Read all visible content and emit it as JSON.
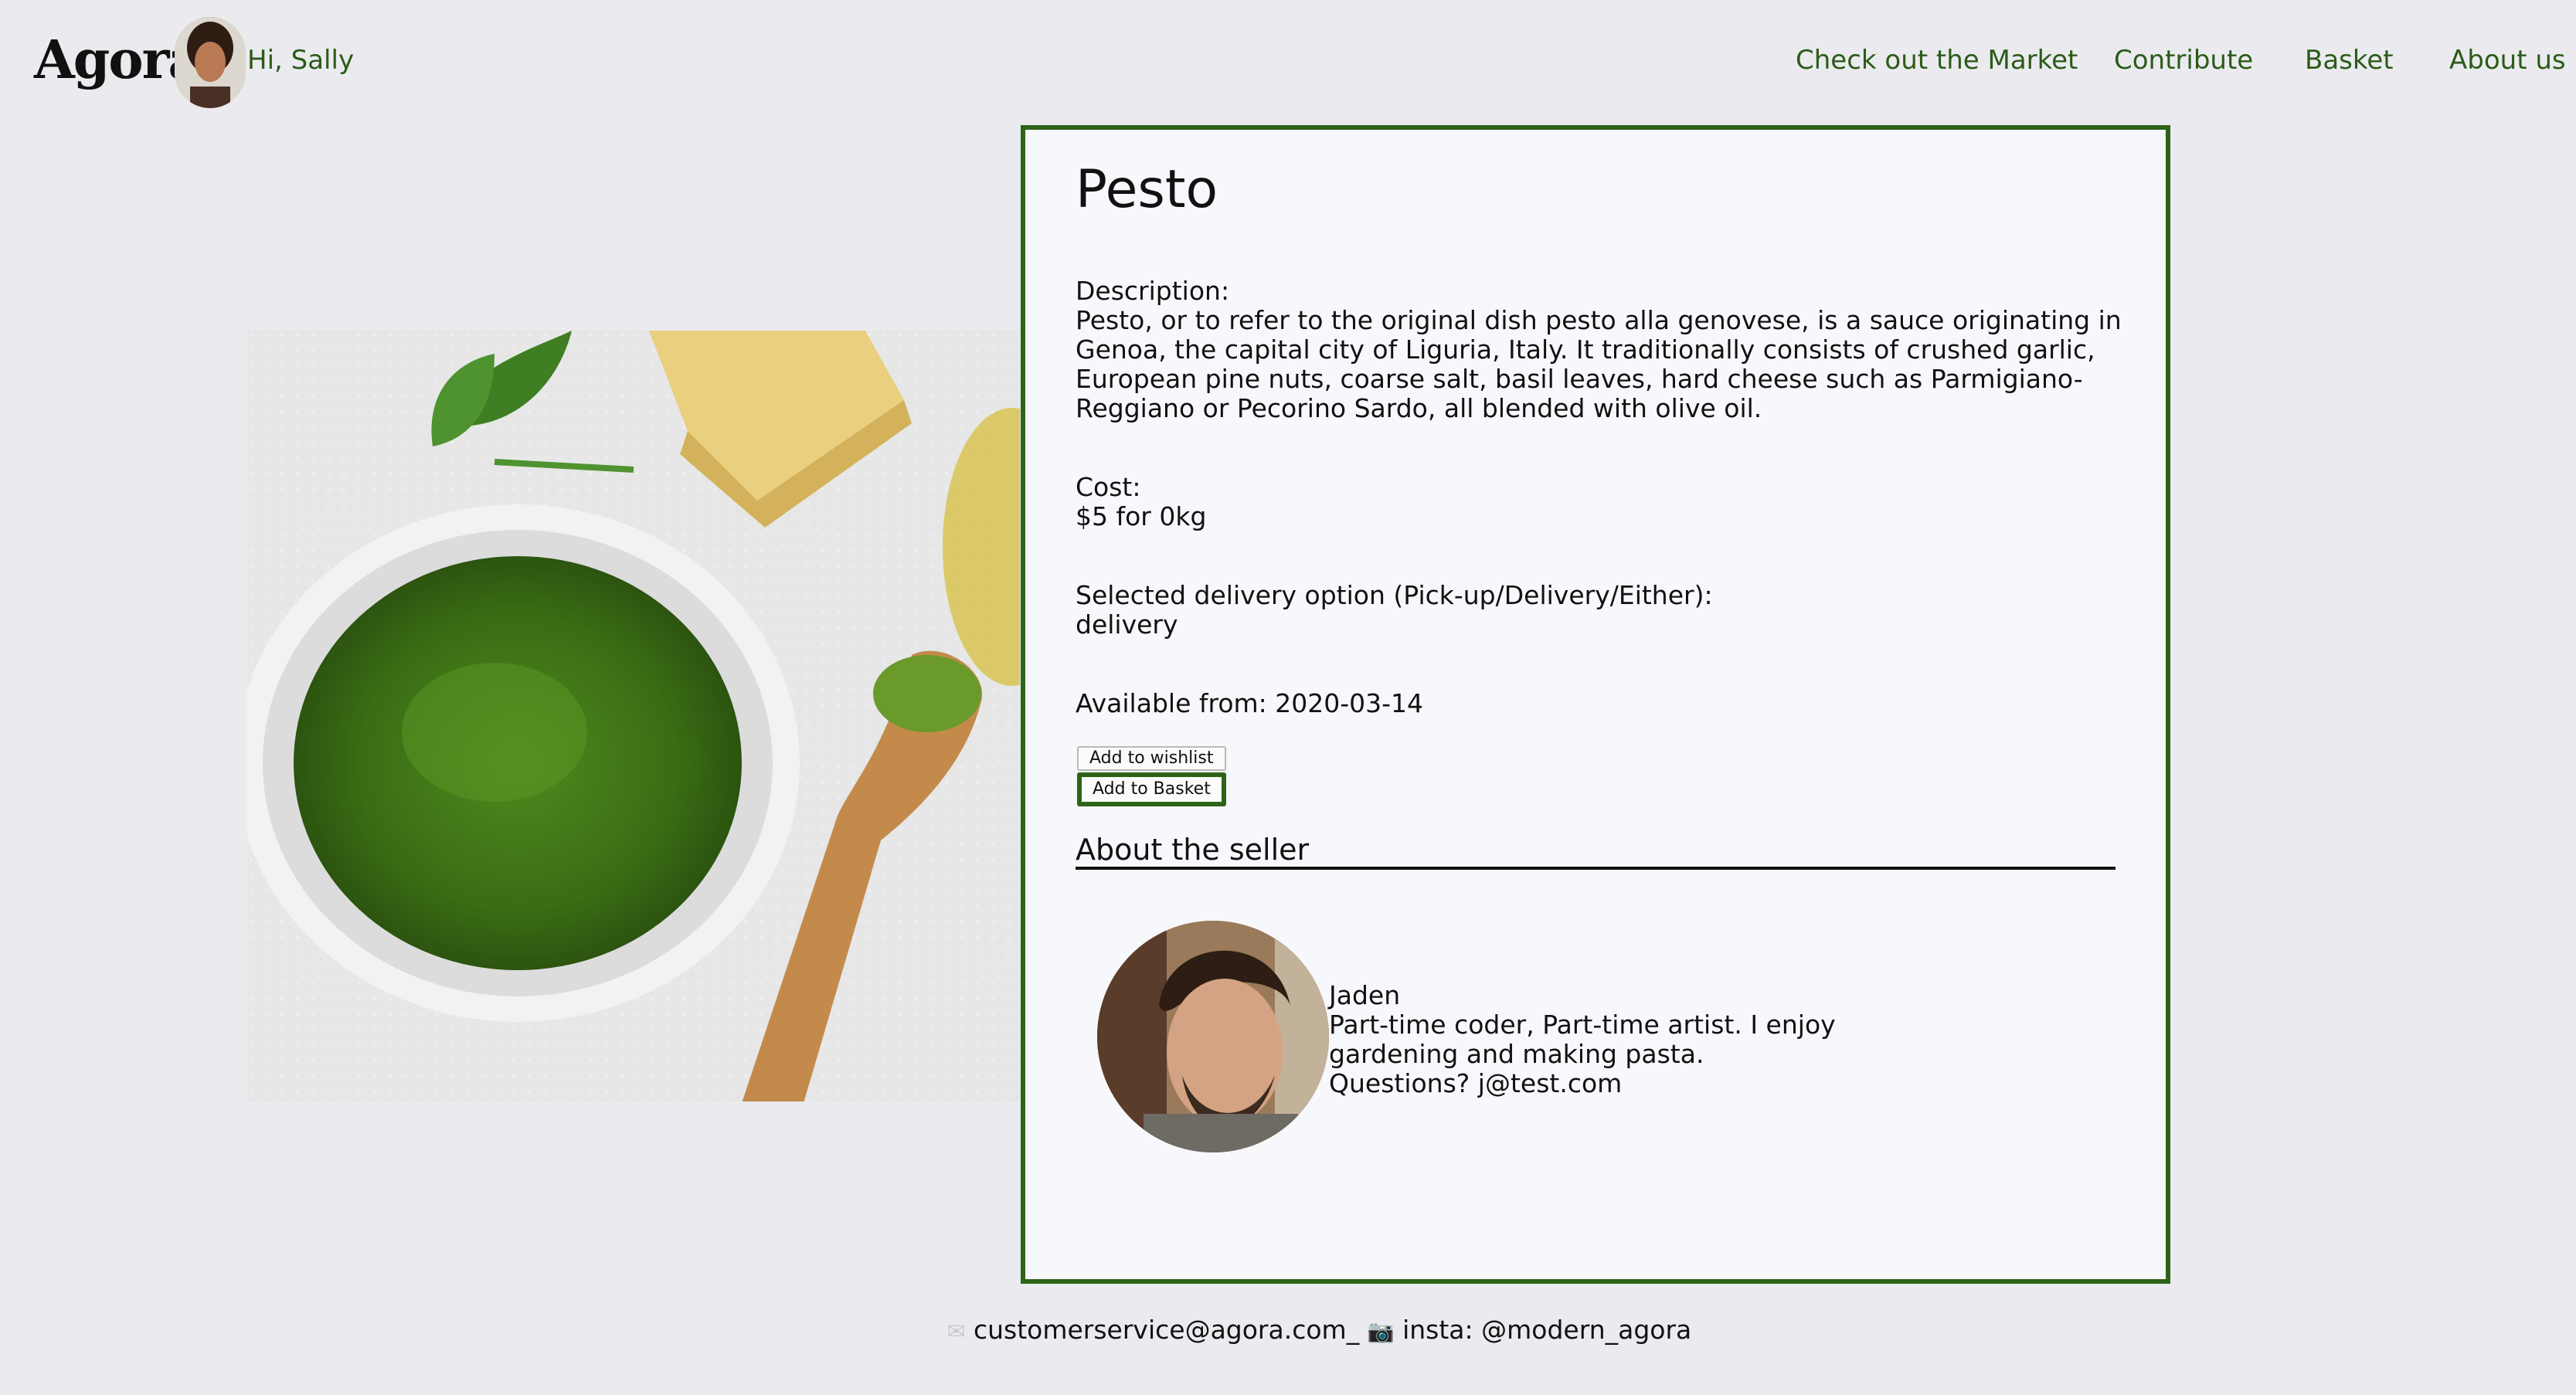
{
  "header": {
    "logo": "Agora",
    "greeting": "Hi, Sally",
    "nav": [
      "Check out the Market",
      "Contribute",
      "Basket",
      "About us"
    ]
  },
  "product": {
    "title": "Pesto",
    "description_label": "Description:",
    "description": "Pesto, or to refer to the original dish pesto alla genovese, is a sauce originating in Genoa, the capital city of Liguria, Italy. It traditionally consists of crushed garlic, European pine nuts, coarse salt, basil leaves, hard cheese such as Parmigiano-Reggiano or Pecorino Sardo, all blended with olive oil.",
    "cost_label": "Cost:",
    "cost": "$5 for 0kg",
    "delivery_label": "Selected delivery option (Pick-up/Delivery/Either):",
    "delivery": "delivery",
    "available": "Available from: 2020-03-14",
    "wishlist_button": "Add to wishlist",
    "basket_button": "Add to Basket"
  },
  "seller": {
    "heading": "About the seller",
    "name": "Jaden",
    "bio": "Part-time coder, Part-time artist. I enjoy gardening and making pasta.",
    "contact": "Questions? j@test.com"
  },
  "footer": {
    "email_icon": "envelope-icon",
    "email": "customerservice@agora.com_",
    "camera_icon": "camera-icon",
    "insta": "insta: @modern_agora"
  },
  "colors": {
    "accent": "#2d6418",
    "nav_text": "#2b5b17",
    "background": "#ebebef",
    "card": "#f7f8fc"
  }
}
